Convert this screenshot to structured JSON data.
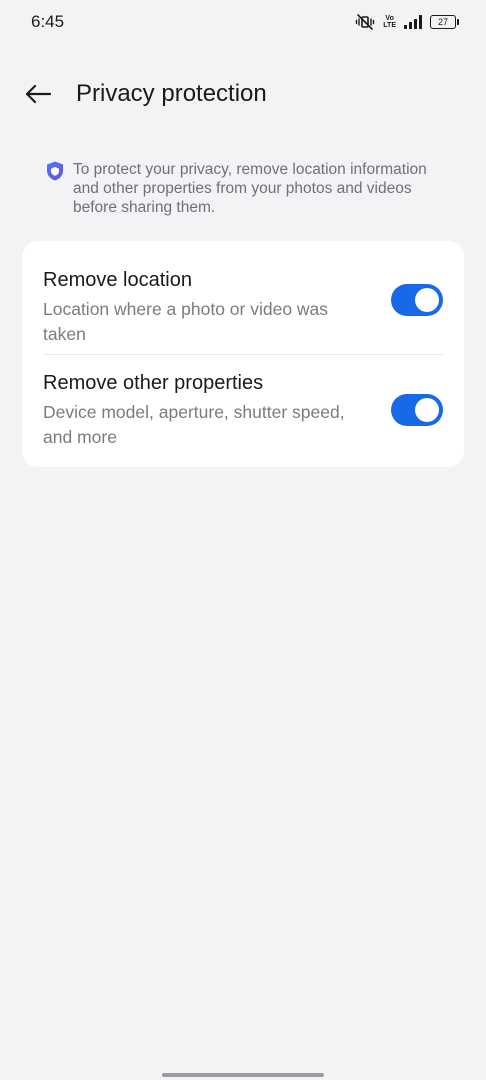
{
  "status_bar": {
    "time": "6:45",
    "volte_top": "Vo",
    "volte_bottom": "LTE",
    "battery": "27",
    "icons": [
      "vibrate-mute-icon",
      "volte-icon",
      "signal-icon",
      "battery-icon"
    ]
  },
  "header": {
    "back_icon": "arrow-left-icon",
    "title": "Privacy protection"
  },
  "info": {
    "icon": "shield-icon",
    "text": "To protect your privacy, remove location information and other properties from your photos and videos before sharing them."
  },
  "settings": [
    {
      "title": "Remove location",
      "description": "Location where a photo or video was taken",
      "enabled": true
    },
    {
      "title": "Remove other properties",
      "description": "Device model, aperture, shutter speed, and more",
      "enabled": true
    }
  ],
  "colors": {
    "accent": "#1769e8",
    "background": "#f2f3f5",
    "card": "#ffffff"
  }
}
